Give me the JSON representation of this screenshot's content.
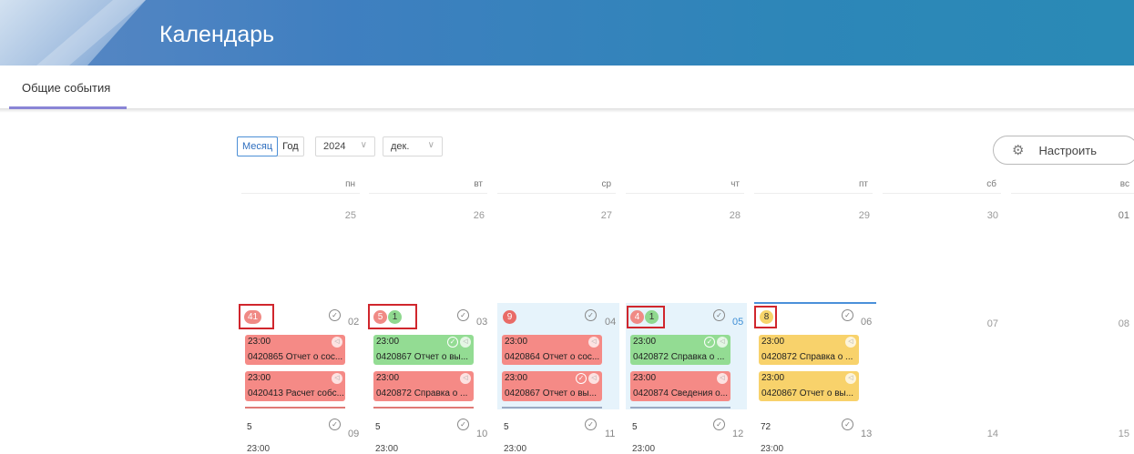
{
  "header": {
    "title": "Календарь"
  },
  "tabs": [
    {
      "label": "Общие события"
    }
  ],
  "controls": {
    "view_month": "Месяц",
    "view_year": "Год",
    "year": "2024",
    "month": "дек.",
    "configure": "Настроить"
  },
  "weekdays": [
    "пн",
    "вт",
    "ср",
    "чт",
    "пт",
    "сб",
    "вс"
  ],
  "week1": [
    "25",
    "26",
    "27",
    "28",
    "29",
    "30",
    "01"
  ],
  "week2": {
    "days": [
      "02",
      "03",
      "04",
      "05",
      "06",
      "07",
      "08"
    ],
    "badges": {
      "mon": [
        "41"
      ],
      "tue": [
        "5",
        "1"
      ],
      "wed": [
        "9"
      ],
      "thu": [
        "4",
        "1"
      ],
      "fri": [
        "8"
      ]
    },
    "events": {
      "mon": [
        {
          "time": "23:00",
          "text": "0420865 Отчет о сос..."
        },
        {
          "time": "23:00",
          "text": "0420413 Расчет собс..."
        }
      ],
      "tue": [
        {
          "time": "23:00",
          "text": "0420867 Отчет о вы..."
        },
        {
          "time": "23:00",
          "text": "0420872 Справка о ..."
        }
      ],
      "wed": [
        {
          "time": "23:00",
          "text": "0420864 Отчет о сос..."
        },
        {
          "time": "23:00",
          "text": "0420867 Отчет о вы..."
        }
      ],
      "thu": [
        {
          "time": "23:00",
          "text": "0420872 Справка о ..."
        },
        {
          "time": "23:00",
          "text": "0420874 Сведения о..."
        }
      ],
      "fri": [
        {
          "time": "23:00",
          "text": "0420872 Справка о ..."
        },
        {
          "time": "23:00",
          "text": "0420867 Отчет о вы..."
        }
      ]
    }
  },
  "week3": {
    "days": [
      "09",
      "10",
      "11",
      "12",
      "13",
      "14",
      "15"
    ],
    "counts": [
      "5",
      "5",
      "5",
      "5",
      "72"
    ],
    "times": [
      "23:00",
      "23:00",
      "23:00",
      "23:00",
      "23:00"
    ]
  },
  "colors": {
    "overdue": "#f58a86",
    "done": "#93dc93",
    "pending": "#f8d26b",
    "accent": "#4a90d9"
  }
}
